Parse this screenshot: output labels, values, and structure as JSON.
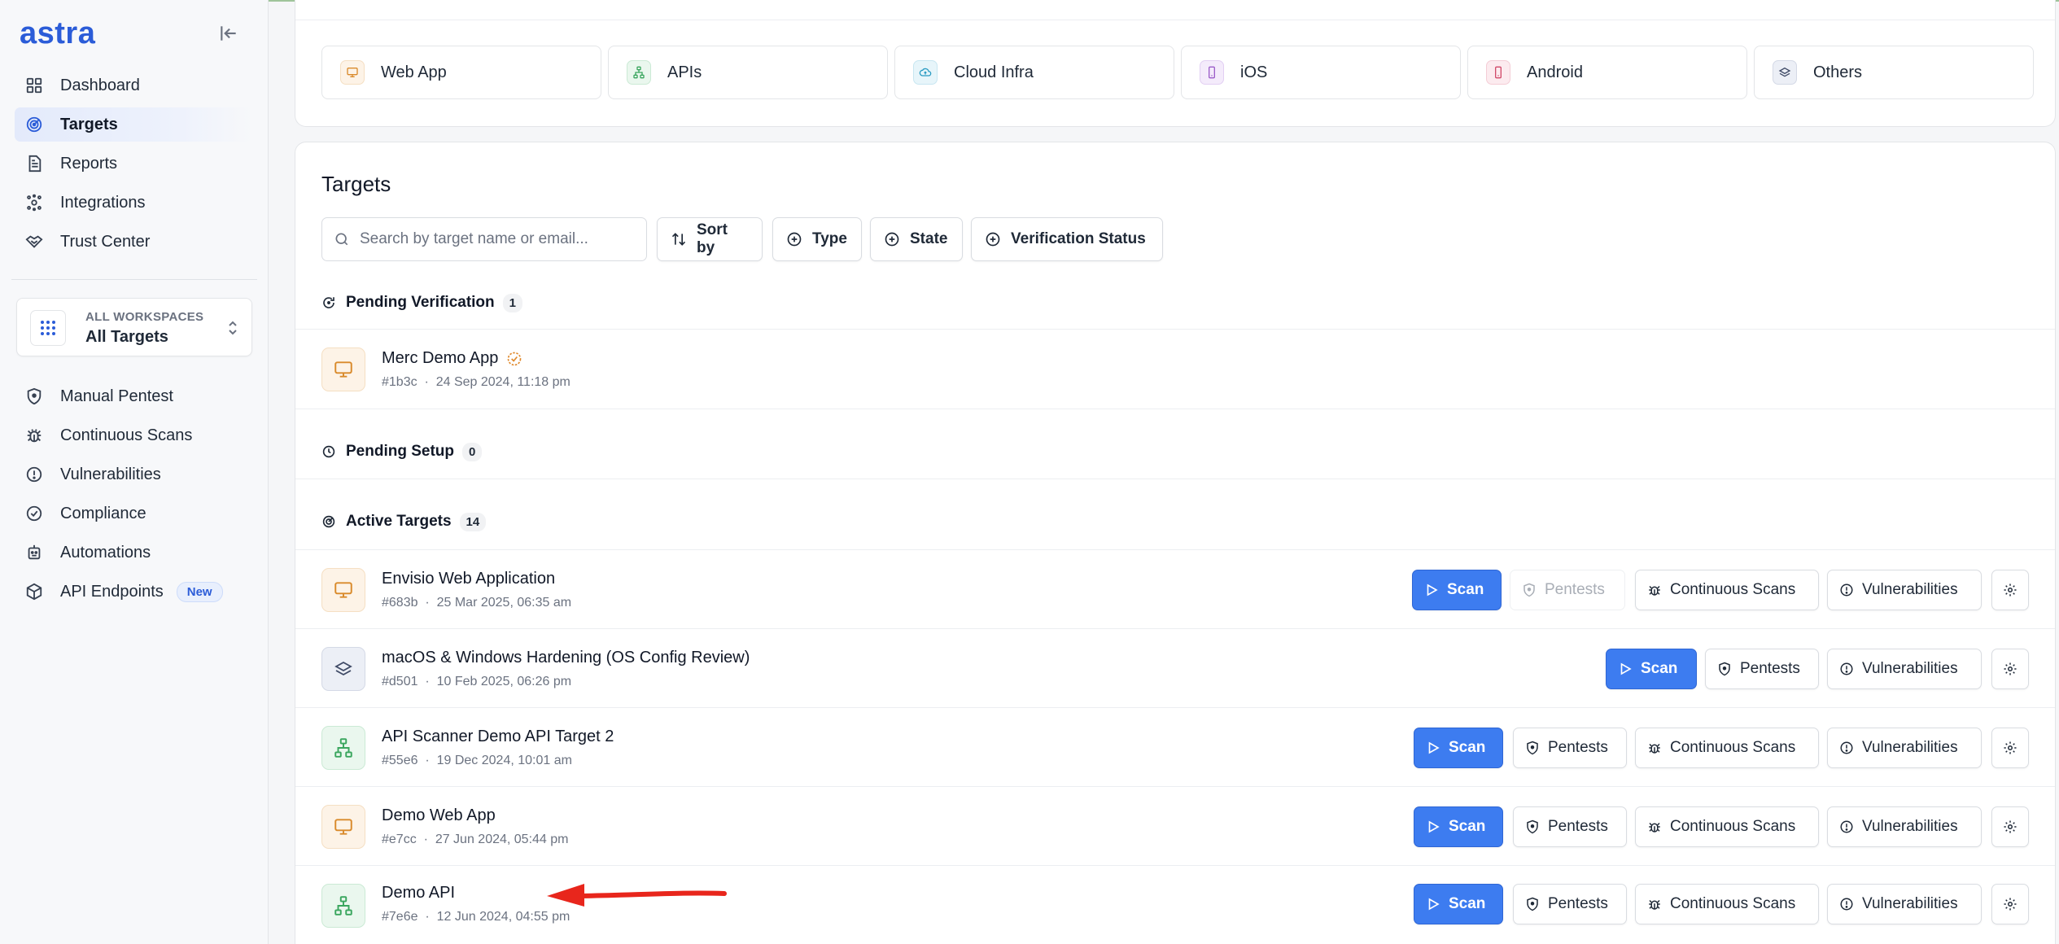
{
  "app": {
    "logo": "astra"
  },
  "sidebar": {
    "nav": [
      {
        "label": "Dashboard",
        "icon": "dashboard-icon",
        "active": false
      },
      {
        "label": "Targets",
        "icon": "target-icon",
        "active": true
      },
      {
        "label": "Reports",
        "icon": "report-icon",
        "active": false
      },
      {
        "label": "Integrations",
        "icon": "integrations-icon",
        "active": false
      },
      {
        "label": "Trust Center",
        "icon": "handshake-icon",
        "active": false
      }
    ],
    "workspace": {
      "caption": "ALL WORKSPACES",
      "name": "All Targets"
    },
    "nav2": [
      {
        "label": "Manual Pentest",
        "icon": "shield-icon"
      },
      {
        "label": "Continuous Scans",
        "icon": "bug-icon"
      },
      {
        "label": "Vulnerabilities",
        "icon": "alert-circle-icon"
      },
      {
        "label": "Compliance",
        "icon": "check-circle-icon"
      },
      {
        "label": "Automations",
        "icon": "robot-icon"
      },
      {
        "label": "API Endpoints",
        "icon": "cube-icon",
        "badge": "New"
      }
    ]
  },
  "categories": [
    {
      "label": "Web App",
      "icon": "monitor-icon"
    },
    {
      "label": "APIs",
      "icon": "api-icon"
    },
    {
      "label": "Cloud Infra",
      "icon": "cloud-icon"
    },
    {
      "label": "iOS",
      "icon": "phone-icon"
    },
    {
      "label": "Android",
      "icon": "phone-icon"
    },
    {
      "label": "Others",
      "icon": "layers-icon"
    }
  ],
  "targets": {
    "title": "Targets",
    "search_placeholder": "Search by target name or email...",
    "filters": {
      "sort": "Sort by",
      "type": "Type",
      "state": "State",
      "verification": "Verification Status"
    },
    "sections": {
      "pending_verification": {
        "label": "Pending Verification",
        "count": "1"
      },
      "pending_setup": {
        "label": "Pending Setup",
        "count": "0"
      },
      "active": {
        "label": "Active Targets",
        "count": "14"
      }
    },
    "pending": [
      {
        "name": "Merc Demo App",
        "id": "#1b3c",
        "date": "24 Sep 2024, 11:18 pm",
        "kind": "web"
      }
    ],
    "active": [
      {
        "name": "Envisio Web Application",
        "id": "#683b",
        "date": "25 Mar 2025, 06:35 am",
        "kind": "web"
      },
      {
        "name": "macOS & Windows Hardening (OS Config Review)",
        "id": "#d501",
        "date": "10 Feb 2025, 06:26 pm",
        "kind": "os"
      },
      {
        "name": "API Scanner Demo API Target 2",
        "id": "#55e6",
        "date": "19 Dec 2024, 10:01 am",
        "kind": "api"
      },
      {
        "name": "Demo Web App",
        "id": "#e7cc",
        "date": "27 Jun 2024, 05:44 pm",
        "kind": "web"
      },
      {
        "name": "Demo API",
        "id": "#7e6e",
        "date": "12 Jun 2024, 04:55 pm",
        "kind": "api"
      }
    ],
    "actions": {
      "scan": "Scan",
      "pentests": "Pentests",
      "continuous": "Continuous Scans",
      "vulns": "Vulnerabilities"
    },
    "meta_sep": "·"
  },
  "colors": {
    "accent": "#2b5cd8",
    "scan_button": "#3d7cf0",
    "annotation_arrow": "#e8261c"
  }
}
